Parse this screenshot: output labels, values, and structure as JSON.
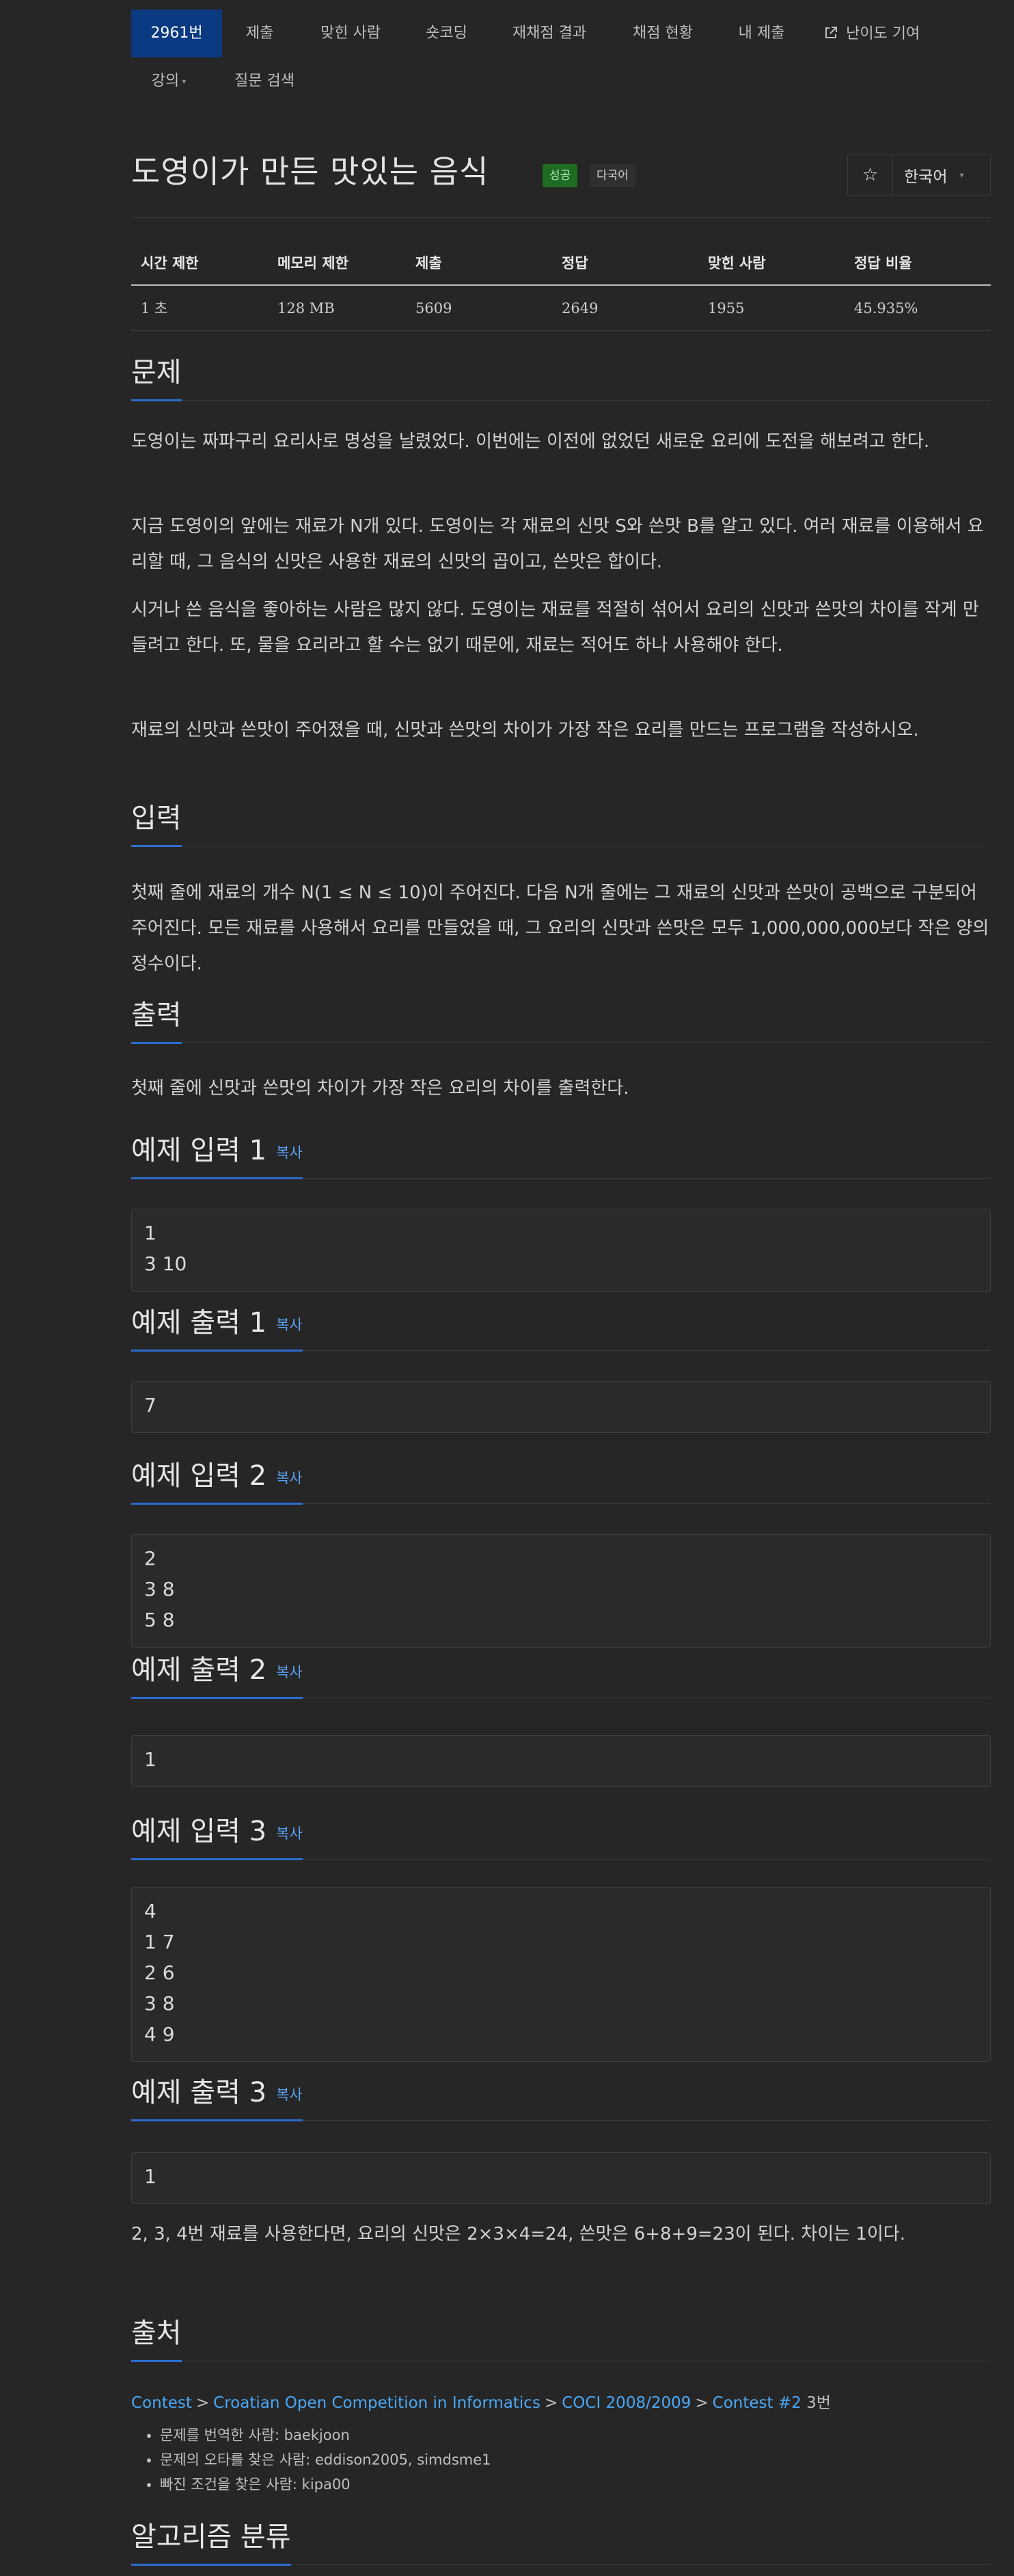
{
  "nav": {
    "items": [
      {
        "label": "2961번"
      },
      {
        "label": "제출"
      },
      {
        "label": "맞힌 사람"
      },
      {
        "label": "숏코딩"
      },
      {
        "label": "재채점 결과"
      },
      {
        "label": "채점 현황"
      },
      {
        "label": "내 제출"
      },
      {
        "label": "난이도 기여"
      }
    ],
    "row2": [
      {
        "label": "강의"
      },
      {
        "label": "질문 검색"
      }
    ]
  },
  "problem": {
    "title": "도영이가 만든 맛있는 음식",
    "badge_success": "성공",
    "badge_multi": "다국어",
    "lang_select": "한국어"
  },
  "info": {
    "headers": [
      "시간 제한",
      "메모리 제한",
      "제출",
      "정답",
      "맞힌 사람",
      "정답 비율"
    ],
    "values": [
      "1 초",
      "128 MB",
      "5609",
      "2649",
      "1955",
      "45.935%"
    ]
  },
  "sections": {
    "problem_title": "문제",
    "problem_paras": [
      "도영이는 짜파구리 요리사로 명성을 날렸었다. 이번에는 이전에 없었던 새로운 요리에 도전을 해보려고 한다.",
      "지금 도영이의 앞에는 재료가 N개 있다. 도영이는 각 재료의 신맛 S와 쓴맛 B를 알고 있다. 여러 재료를 이용해서 요리할 때, 그 음식의 신맛은 사용한 재료의 신맛의 곱이고, 쓴맛은 합이다.",
      "시거나 쓴 음식을 좋아하는 사람은 많지 않다. 도영이는 재료를 적절히 섞어서 요리의 신맛과 쓴맛의 차이를 작게 만들려고 한다. 또, 물을 요리라고 할 수는 없기 때문에, 재료는 적어도 하나 사용해야 한다.",
      "재료의 신맛과 쓴맛이 주어졌을 때, 신맛과 쓴맛의 차이가 가장 작은 요리를 만드는 프로그램을 작성하시오."
    ],
    "input_title": "입력",
    "input_para": "첫째 줄에 재료의 개수 N(1 ≤ N ≤ 10)이 주어진다. 다음 N개 줄에는 그 재료의 신맛과 쓴맛이 공백으로 구분되어 주어진다. 모든 재료를 사용해서 요리를 만들었을 때, 그 요리의 신맛과 쓴맛은 모두 1,000,000,000보다 작은 양의 정수이다.",
    "output_title": "출력",
    "output_para": "첫째 줄에 신맛과 쓴맛의 차이가 가장 작은 요리의 차이를 출력한다.",
    "copy_label": "복사",
    "sample_in_1_title": "예제 입력 1",
    "sample_in_1": "1\n3 10",
    "sample_out_1_title": "예제 출력 1",
    "sample_out_1": "7",
    "sample_in_2_title": "예제 입력 2",
    "sample_in_2": "2\n3 8\n5 8",
    "sample_out_2_title": "예제 출력 2",
    "sample_out_2": "1",
    "sample_in_3_title": "예제 입력 3",
    "sample_in_3": "4\n1 7\n2 6\n3 8\n4 9",
    "sample_out_3_title": "예제 출력 3",
    "sample_out_3": "1",
    "sample_3_note": "2, 3, 4번 재료를 사용한다면, 요리의 신맛은 2×3×4=24, 쓴맛은 6+8+9=23이 된다. 차이는 1이다.",
    "source_title": "출처",
    "source_links": [
      "Contest",
      "Croatian Open Competition in Informatics",
      "COCI 2008/2009",
      "Contest #2"
    ],
    "source_suffix": "3번",
    "credits": [
      "문제를 번역한 사람: baekjoon",
      "문제의 오타를 찾은 사람: eddison2005, simdsme1",
      "빠진 조건을 찾은 사람: kipa00"
    ],
    "algo_title": "알고리즘 분류"
  }
}
